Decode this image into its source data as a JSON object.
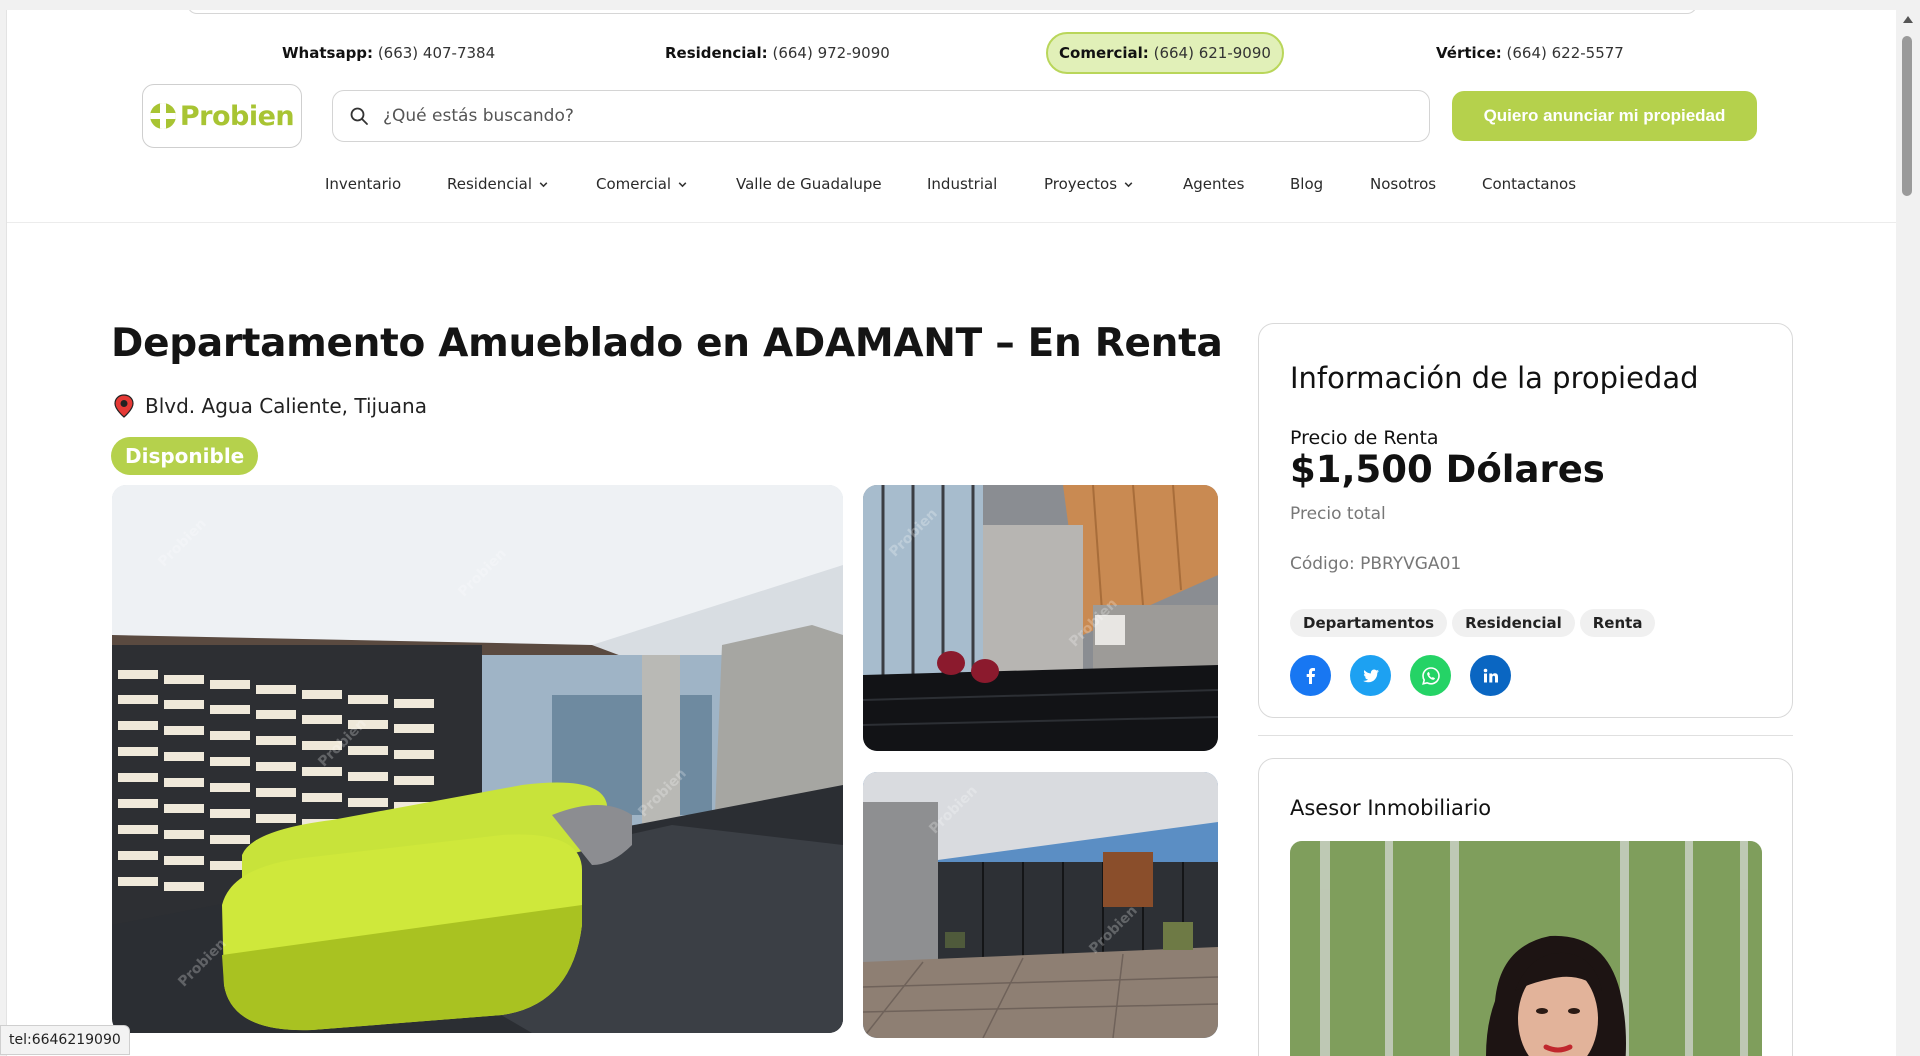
{
  "contacts": [
    {
      "label": "Whatsapp:",
      "value": "(663) 407-7384"
    },
    {
      "label": "Residencial:",
      "value": "(664) 972-9090"
    },
    {
      "label": "Comercial:",
      "value": "(664) 621-9090"
    },
    {
      "label": "Vértice:",
      "value": "(664) 622-5577"
    }
  ],
  "header": {
    "logo_text": "Probien",
    "search_placeholder": "¿Qué estás buscando?",
    "cta_label": "Quiero anunciar mi propiedad"
  },
  "nav": [
    {
      "label": "Inventario"
    },
    {
      "label": "Residencial"
    },
    {
      "label": "Comercial"
    },
    {
      "label": "Valle de Guadalupe"
    },
    {
      "label": "Industrial"
    },
    {
      "label": "Proyectos"
    },
    {
      "label": "Agentes"
    },
    {
      "label": "Blog"
    },
    {
      "label": "Nosotros"
    },
    {
      "label": "Contactanos"
    }
  ],
  "listing": {
    "title": "Departamento Amueblado en ADAMANT – En Renta",
    "location": "Blvd. Agua Caliente, Tijuana",
    "status": "Disponible",
    "watermark": "Probien"
  },
  "info": {
    "heading": "Información de la propiedad",
    "price_label": "Precio de Renta",
    "price": "$1,500 Dólares",
    "price_note": "Precio total",
    "code": "Código: PBRYVGA01",
    "tags": [
      "Departamentos",
      "Residencial",
      "Renta"
    ],
    "share_icons": [
      "facebook-icon",
      "twitter-icon",
      "whatsapp-icon",
      "linkedin-icon"
    ]
  },
  "advisor": {
    "heading": "Asesor Inmobiliario"
  },
  "status_bar": "tel:6646219090",
  "colors": {
    "brand_green": "#b5d14c",
    "active_contact_bg": "#e1f0b8",
    "facebook": "#1877f2",
    "twitter": "#1da1f2",
    "whatsapp": "#25d366",
    "linkedin": "#0a66c2",
    "location_pin": "#e53935"
  }
}
